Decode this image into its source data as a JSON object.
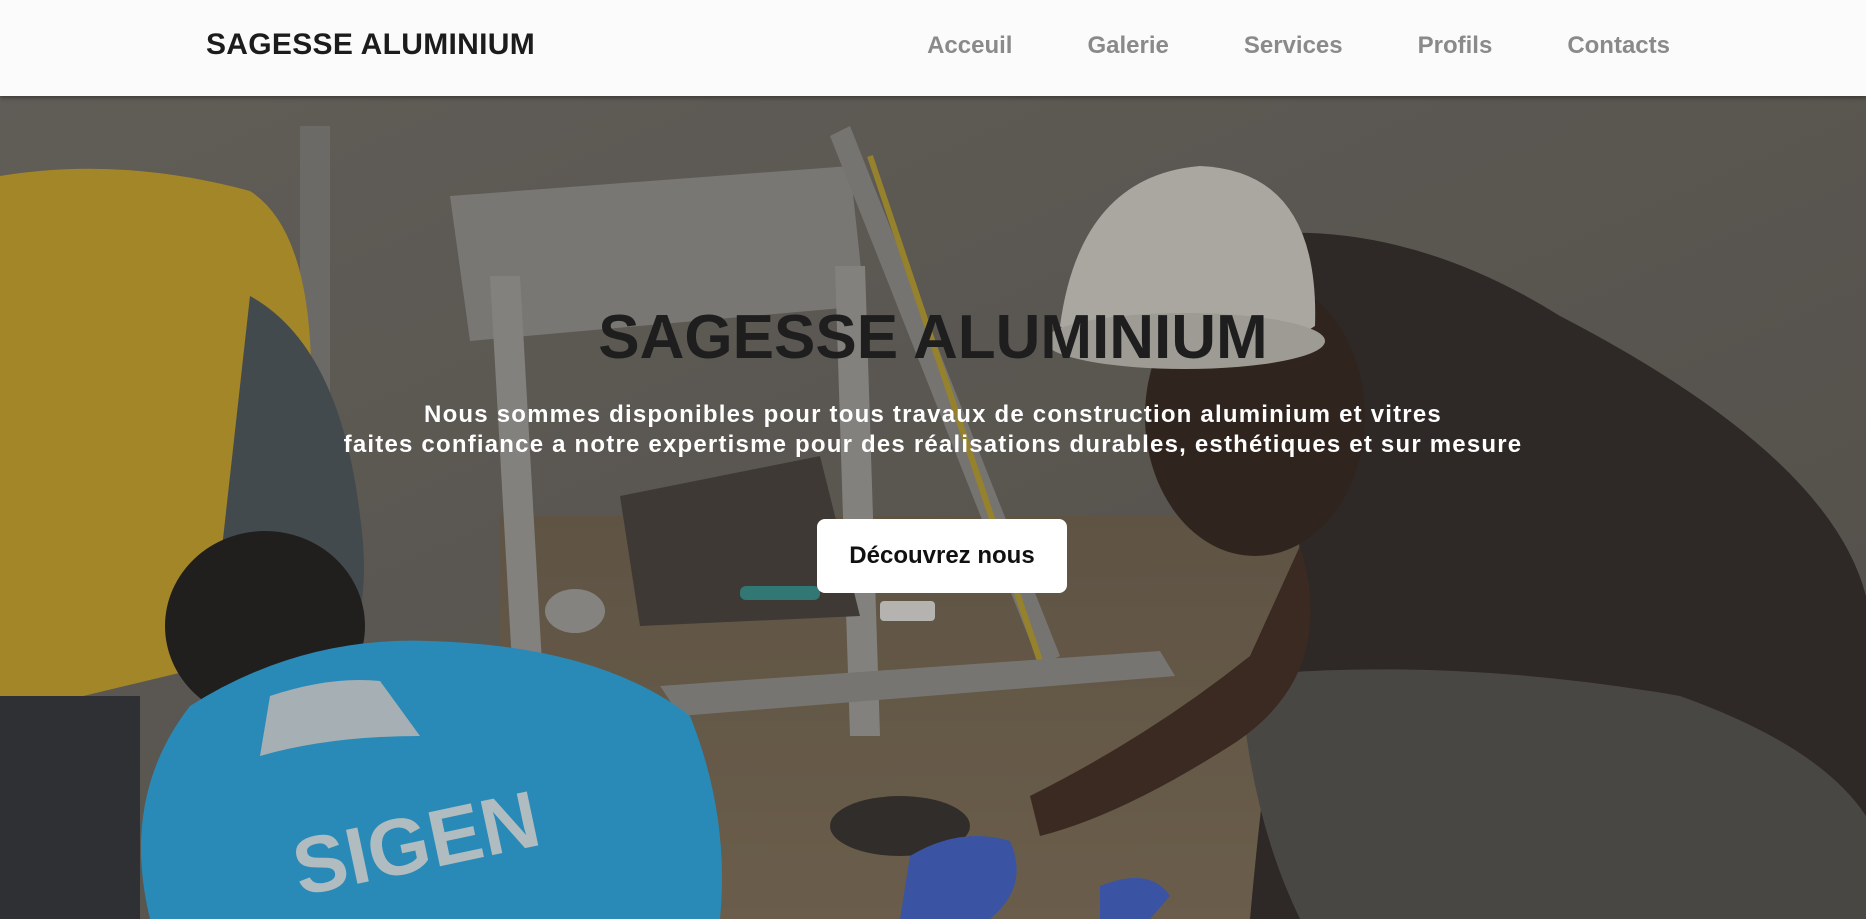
{
  "nav": {
    "brand": "SAGESSE ALUMINIUM",
    "links": [
      "Acceuil",
      "Galerie",
      "Services",
      "Profils",
      "Contacts"
    ]
  },
  "hero": {
    "title": "SAGESSE ALUMINIUM",
    "subtitle_line1": "Nous sommes disponibles pour tous travaux de construction aluminium et vitres",
    "subtitle_line2": "faites confiance a notre expertisme pour des réalisations durables, esthétiques et sur mesure",
    "cta_label": "Découvrez nous",
    "shirt_logo_text": "SIGEN"
  },
  "colors": {
    "nav_bg": "#fbfbfb",
    "brand_text": "#1c1c1c",
    "nav_link": "#8a8a8a",
    "hero_title": "#1e1e1e",
    "hero_sub": "#ffffff",
    "cta_bg": "#ffffff"
  }
}
